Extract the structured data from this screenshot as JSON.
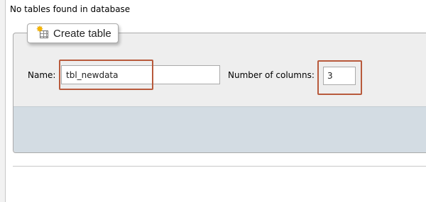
{
  "notice": "No tables found in database",
  "create_table": {
    "legend_label": "Create table",
    "legend_icon": "new-table-icon",
    "name_label": "Name:",
    "name_value": "tbl_newdata",
    "columns_label": "Number of columns:",
    "columns_value": "3",
    "highlight_color": "#b85a3c",
    "footer_color": "#d3dce3",
    "panel_color": "#eeeeee"
  }
}
